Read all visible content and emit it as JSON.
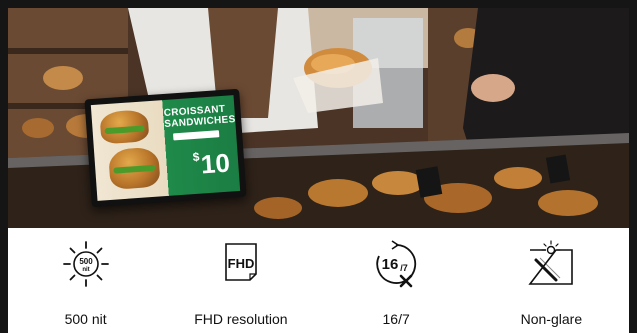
{
  "features": [
    {
      "icon": "brightness-500nit-icon",
      "icon_text": "500",
      "icon_subtext": "nit",
      "label": "500 nit"
    },
    {
      "icon": "fhd-icon",
      "icon_text": "FHD",
      "label": "FHD resolution"
    },
    {
      "icon": "operating-hours-icon",
      "icon_text": "16",
      "icon_subtext": "/7",
      "label": "16/7"
    },
    {
      "icon": "non-glare-icon",
      "label": "Non-glare"
    }
  ],
  "photo": {
    "sign_title": "CROISSANT SANDWICHES",
    "sign_price_symbol": "$",
    "sign_price": "10"
  }
}
